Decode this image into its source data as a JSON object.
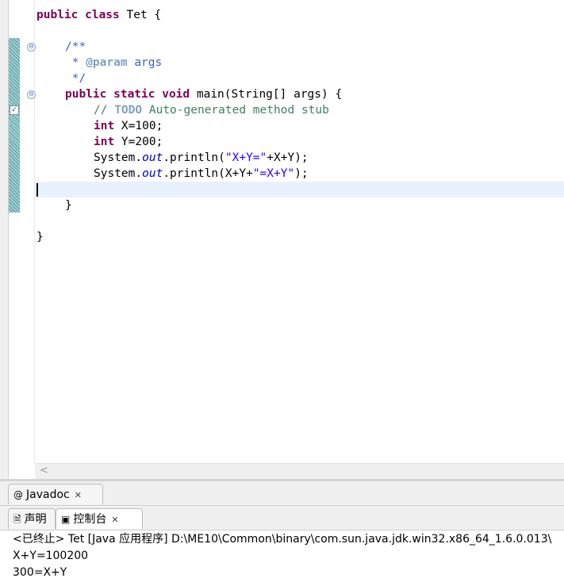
{
  "editor": {
    "line_1": {
      "kw": "public class",
      "rest": " Tet {"
    },
    "line_3": "/**",
    "line_4": {
      "prefix": " * ",
      "tag": "@param",
      "rest": " args"
    },
    "line_5": " */",
    "line_6": {
      "kw": "public static void",
      "rest": " main(String[] args) {"
    },
    "line_7": {
      "prefix": "// ",
      "todo": "TODO",
      "rest": " Auto-generated method stub"
    },
    "line_8": {
      "kw": "int",
      "rest": " X=100;"
    },
    "line_9": {
      "kw": "int",
      "rest": " Y=200;"
    },
    "line_10": {
      "a": "System.",
      "fld": "out",
      "b": ".println(",
      "str": "\"X+Y=\"",
      "c": "+X+Y);"
    },
    "line_11": {
      "a": "System.",
      "fld": "out",
      "b": ".println(X+Y+",
      "str": "\"=X+Y\"",
      "c": ");"
    },
    "line_13": "}",
    "line_15": "}"
  },
  "icons": {
    "fold": "⊖",
    "task": "✓",
    "scroll_left": "<"
  },
  "views": {
    "javadoc_tab": {
      "icon": "@",
      "label": "Javadoc",
      "close": "✕"
    },
    "declaration_tab": {
      "icon": "🗎",
      "label": "声明"
    },
    "console_tab": {
      "icon": "▣",
      "label": "控制台",
      "close": "✕"
    }
  },
  "console": {
    "header": "<已终止> Tet [Java 应用程序] D:\\ME10\\Common\\binary\\com.sun.java.jdk.win32.x86_64_1.6.0.013\\",
    "output": [
      "X+Y=100200",
      "300=X+Y"
    ]
  },
  "colors": {
    "keyword": "#7f0055",
    "comment": "#3f5fbf",
    "string": "#2a00ff",
    "field": "#0000c0",
    "current_line": "#e8f2fe"
  }
}
